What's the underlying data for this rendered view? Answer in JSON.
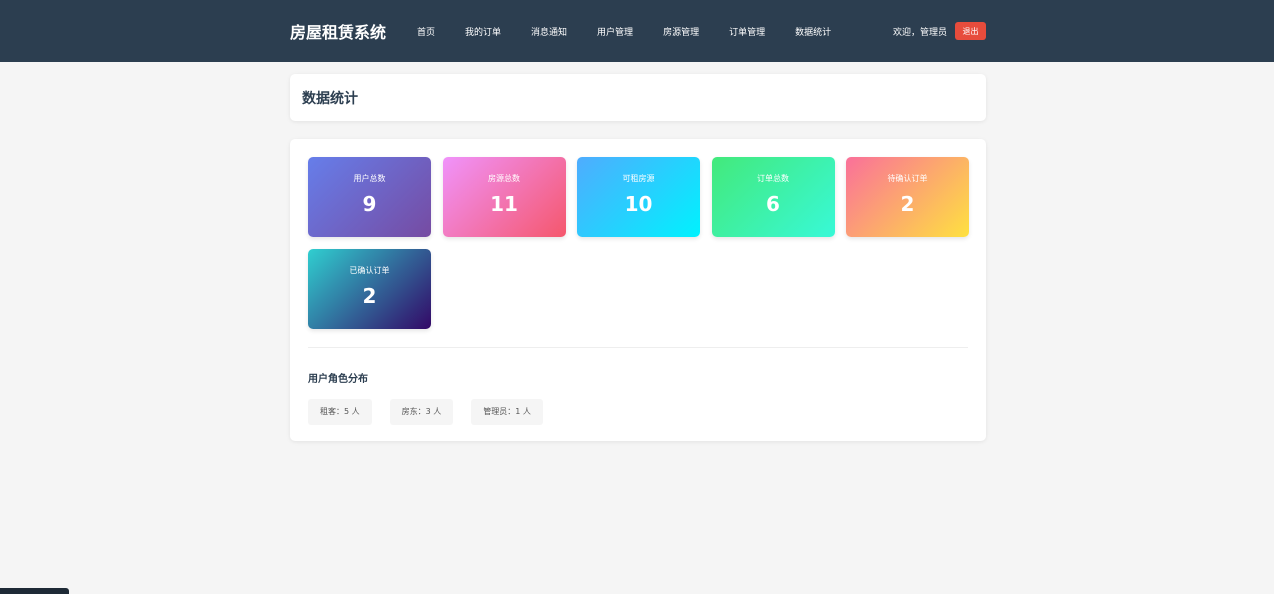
{
  "header": {
    "brand": "房屋租赁系统",
    "nav": [
      "首页",
      "我的订单",
      "消息通知",
      "用户管理",
      "房源管理",
      "订单管理",
      "数据统计"
    ],
    "welcome": "欢迎，管理员",
    "logout_label": "退出"
  },
  "page": {
    "title": "数据统计"
  },
  "stats": [
    {
      "label": "用户总数",
      "value": "9"
    },
    {
      "label": "房源总数",
      "value": "11"
    },
    {
      "label": "可租房源",
      "value": "10"
    },
    {
      "label": "订单总数",
      "value": "6"
    },
    {
      "label": "待确认订单",
      "value": "2"
    },
    {
      "label": "已确认订单",
      "value": "2"
    }
  ],
  "roles": {
    "title": "用户角色分布",
    "items": [
      "租客：5 人",
      "房东：3 人",
      "管理员：1 人"
    ]
  },
  "colors": {
    "navbar": "#2c3e50",
    "logout": "#e74c3c",
    "background": "#f5f5f5"
  }
}
